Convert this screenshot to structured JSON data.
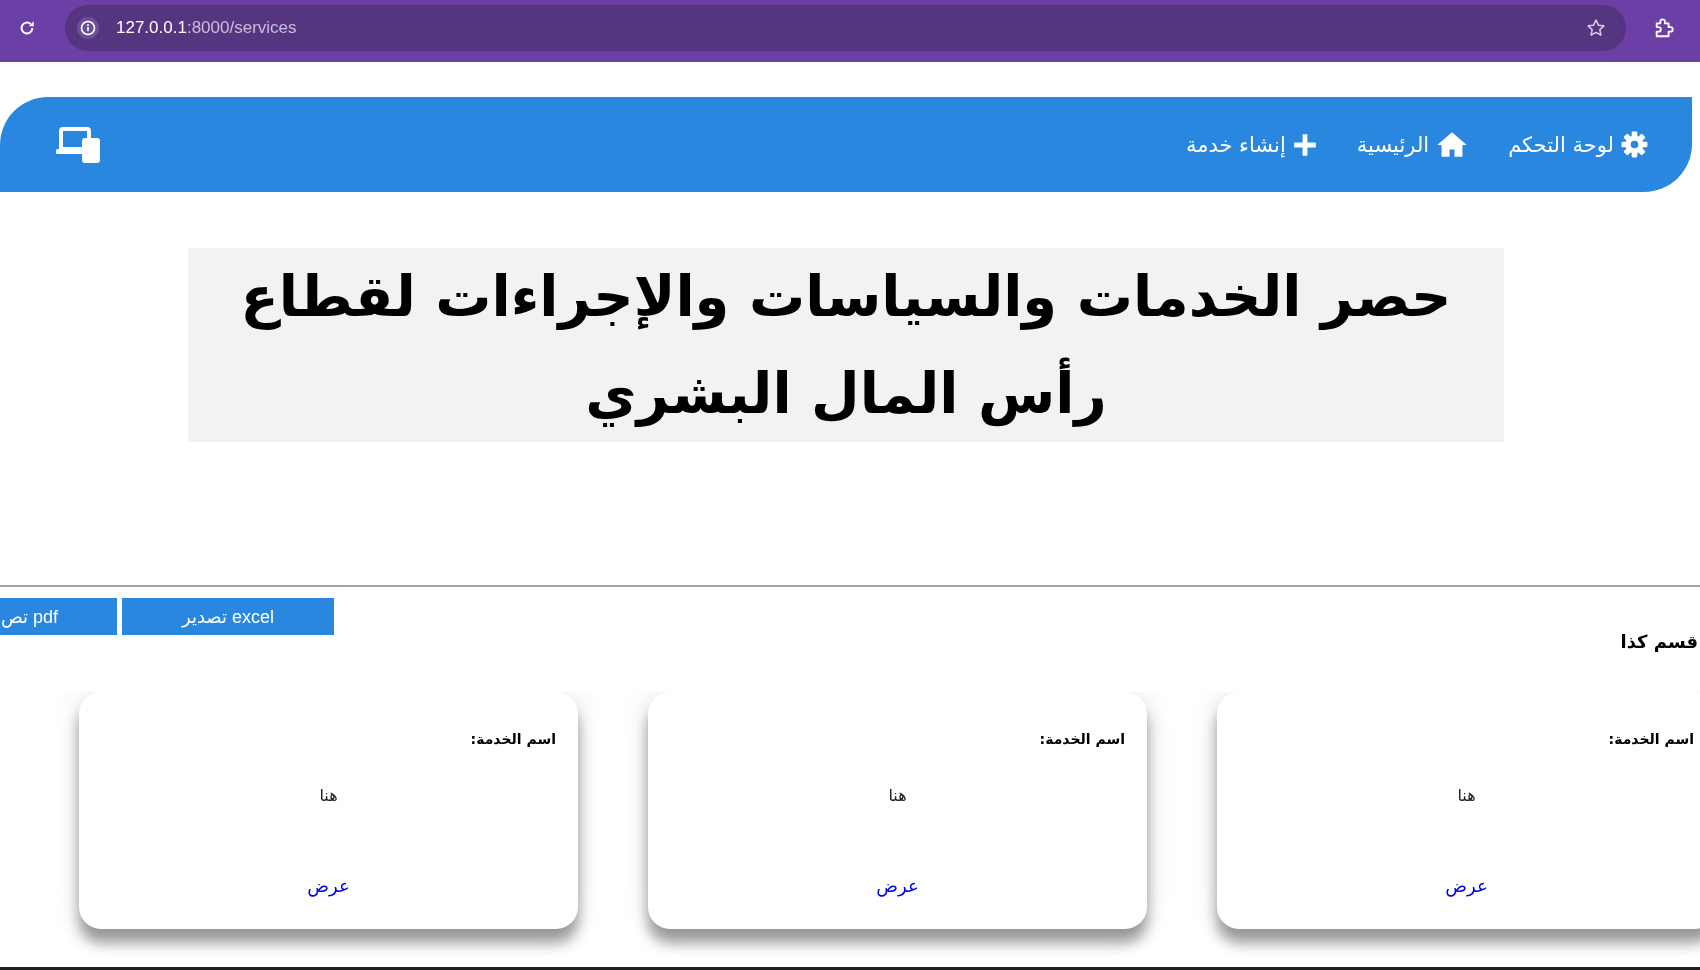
{
  "browser": {
    "url_host": "127.0.0.1",
    "url_path": ":8000/services"
  },
  "navbar": {
    "items": [
      {
        "label": "لوحة التحكم"
      },
      {
        "label": "الرئيسية"
      },
      {
        "label": "إنشاء خدمة"
      }
    ]
  },
  "title": "حصر الخدمات والسياسات والإجراءات لقطاع رأس المال البشري",
  "export_buttons": [
    {
      "label": "تصدير excel"
    },
    {
      "label": "تص pdf"
    }
  ],
  "section": {
    "heading": "قسم كذا",
    "cards": [
      {
        "label": "اسم الخدمة:",
        "value": "هنا",
        "link": "عرض"
      },
      {
        "label": "اسم الخدمة:",
        "value": "هنا",
        "link": "عرض"
      },
      {
        "label": "اسم الخدمة:",
        "value": "هنا",
        "link": "عرض"
      }
    ]
  }
}
